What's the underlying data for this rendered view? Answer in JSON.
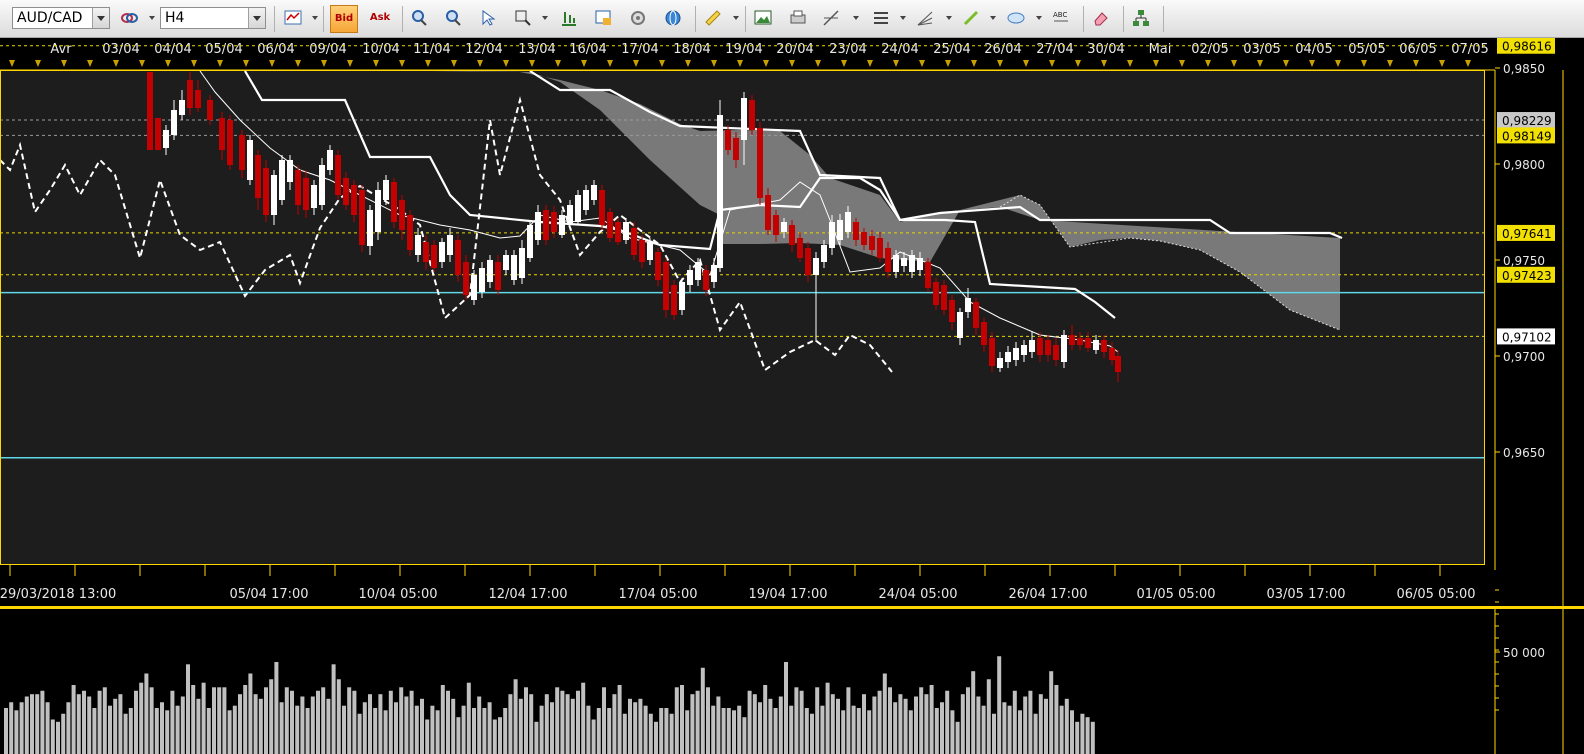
{
  "toolbar": {
    "symbol": "AUD/CAD",
    "timeframe": "H4",
    "bid_label": "Bid",
    "ask_label": "Ask",
    "text_tool_label": "ABC"
  },
  "chart_data": {
    "type": "candlestick",
    "symbol": "AUD/CAD",
    "timeframe": "H4",
    "top_date_labels": [
      "Avr",
      "03/04",
      "04/04",
      "05/04",
      "06/04",
      "09/04",
      "10/04",
      "11/04",
      "12/04",
      "13/04",
      "16/04",
      "17/04",
      "18/04",
      "19/04",
      "20/04",
      "23/04",
      "24/04",
      "25/04",
      "26/04",
      "27/04",
      "30/04",
      "Mai",
      "02/05",
      "03/05",
      "04/05",
      "05/05",
      "06/05",
      "07/05"
    ],
    "bottom_time_labels": [
      "29/03/2018 13:00",
      "05/04 17:00",
      "10/04 05:00",
      "12/04 17:00",
      "17/04 05:00",
      "19/04 17:00",
      "24/04 05:00",
      "26/04 17:00",
      "01/05 05:00",
      "03/05 17:00",
      "06/05 05:00"
    ],
    "price_axis": {
      "min": 0.962,
      "max": 0.987,
      "ticks": [
        "0,9850",
        "0,9800",
        "0,9750",
        "0,9700",
        "0,9650"
      ]
    },
    "price_levels": [
      {
        "label": "0,98616",
        "value": 0.98616,
        "style": "dashed-yellow",
        "badge": "yellow"
      },
      {
        "label": "0,98229",
        "value": 0.98229,
        "style": "dashed-gray",
        "badge": "gray"
      },
      {
        "label": "0,98149",
        "value": 0.98149,
        "style": "dashed-gray",
        "badge": "yellow"
      },
      {
        "label": "0,97641",
        "value": 0.97641,
        "style": "dashed-yellow",
        "badge": "yellow"
      },
      {
        "label": "0,97423",
        "value": 0.97423,
        "style": "dashed-yellow",
        "badge": "yellow"
      },
      {
        "label": "0,97102",
        "value": 0.97102,
        "style": "dashed-yellow",
        "badge": "white"
      }
    ],
    "horizontal_lines": [
      {
        "value": 0.9733,
        "color": "#5fd7e6"
      },
      {
        "value": 0.9647,
        "color": "#5fd7e6"
      }
    ],
    "volume_axis_label": "50 000",
    "colors": {
      "up": "#ffffff",
      "down": "#c40000",
      "frame": "#ffd700",
      "cloud": "#8a8a8a",
      "volume": "#c0c0c0"
    }
  }
}
